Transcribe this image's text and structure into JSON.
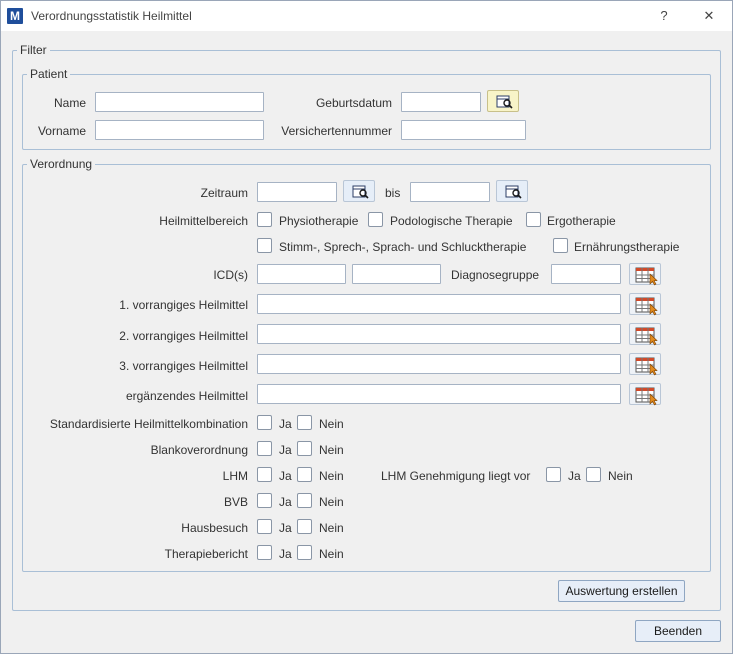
{
  "window": {
    "title": "Verordnungsstatistik Heilmittel",
    "help": "?",
    "close": "✕",
    "app_icon": "M"
  },
  "filter": {
    "legend": "Filter"
  },
  "patient": {
    "legend": "Patient",
    "name_label": "Name",
    "name_value": "",
    "vorname_label": "Vorname",
    "vorname_value": "",
    "geburtsdatum_label": "Geburtsdatum",
    "geburtsdatum_value": "",
    "versichertennummer_label": "Versichertennummer",
    "versichertennummer_value": ""
  },
  "verordnung": {
    "legend": "Verordnung",
    "zeitraum_label": "Zeitraum",
    "zeitraum_from": "",
    "bis_label": "bis",
    "zeitraum_to": "",
    "heilmittelbereich_label": "Heilmittelbereich",
    "bereiche": [
      {
        "label": "Physiotherapie",
        "checked": false
      },
      {
        "label": "Podologische Therapie",
        "checked": false
      },
      {
        "label": "Ergotherapie",
        "checked": false
      },
      {
        "label": "Stimm-, Sprech-, Sprach- und Schlucktherapie",
        "checked": false
      },
      {
        "label": "Ernährungstherapie",
        "checked": false
      }
    ],
    "icd_label": "ICD(s)",
    "icd1": "",
    "icd2": "",
    "diagnosegruppe_label": "Diagnosegruppe",
    "diagnosegruppe": "",
    "heilmittel": [
      {
        "label": "1. vorrangiges Heilmittel",
        "value": ""
      },
      {
        "label": "2. vorrangiges Heilmittel",
        "value": ""
      },
      {
        "label": "3. vorrangiges Heilmittel",
        "value": ""
      },
      {
        "label": "ergänzendes Heilmittel",
        "value": ""
      }
    ],
    "ja_label": "Ja",
    "nein_label": "Nein",
    "yesno": [
      {
        "label": "Standardisierte Heilmittelkombination"
      },
      {
        "label": "Blankoverordnung"
      },
      {
        "label": "LHM"
      },
      {
        "label": "BVB"
      },
      {
        "label": "Hausbesuch"
      },
      {
        "label": "Therapiebericht"
      }
    ],
    "lhm_genehmigung_label": "LHM Genehmigung liegt vor"
  },
  "buttons": {
    "auswertung": "Auswertung erstellen",
    "beenden": "Beenden"
  },
  "icons": {
    "calendar": "calendar-search-icon",
    "lookup": "table-lookup-icon"
  },
  "colors": {
    "border": "#a9bfd6",
    "button_bg": "#e7eef8",
    "highlight": "#f8f4c8",
    "accent": "#1f4e9b"
  }
}
